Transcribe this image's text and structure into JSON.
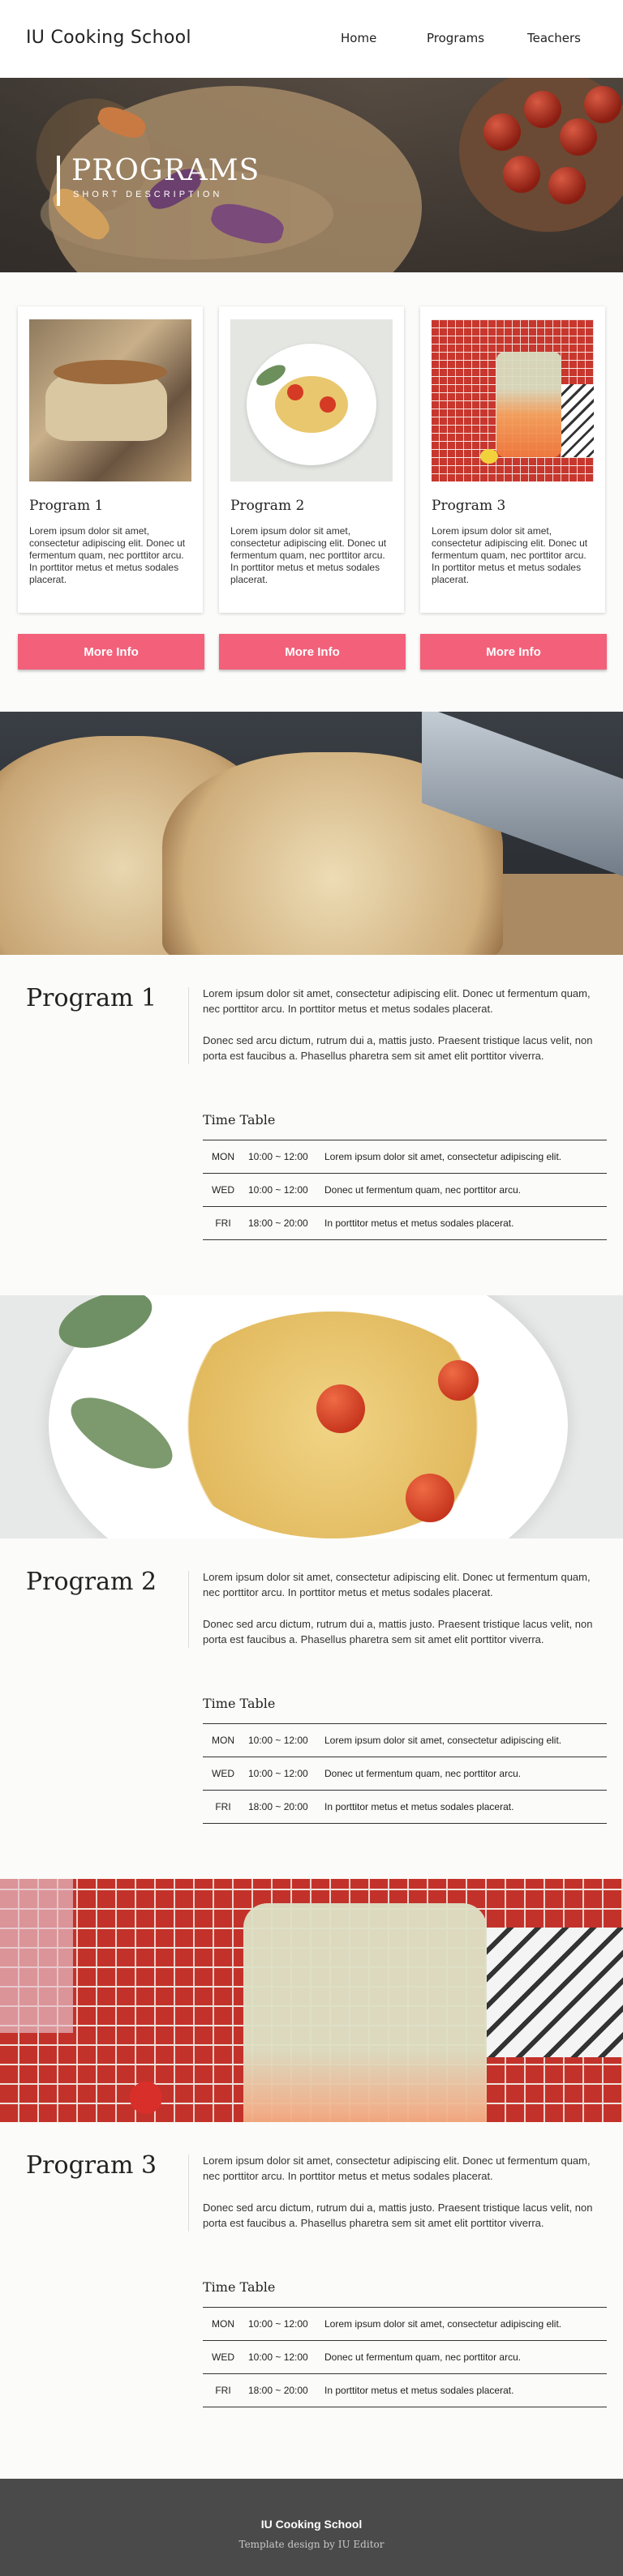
{
  "site": {
    "name": "IU Cooking School"
  },
  "nav": {
    "items": [
      "Home",
      "Programs",
      "Teachers"
    ]
  },
  "hero": {
    "title": "PROGRAMS",
    "subtitle": "SHORT DESCRIPTION"
  },
  "cards": [
    {
      "title": "Program 1",
      "text": "Lorem ipsum dolor sit amet, consectetur adipiscing elit. Donec ut fermentum quam, nec porttitor arcu. In porttitor metus et metus sodales placerat.",
      "button": "More Info"
    },
    {
      "title": "Program 2",
      "text": "Lorem ipsum dolor sit amet, consectetur adipiscing elit. Donec ut fermentum quam, nec porttitor arcu. In porttitor metus et metus sodales placerat.",
      "button": "More Info"
    },
    {
      "title": "Program 3",
      "text": "Lorem ipsum dolor sit amet, consectetur adipiscing elit. Donec ut fermentum quam, nec porttitor arcu. In porttitor metus et metus sodales placerat.",
      "button": "More Info"
    }
  ],
  "programs": [
    {
      "title": "Program 1",
      "para1": "Lorem ipsum dolor sit amet, consectetur adipiscing elit. Donec ut fermentum quam, nec porttitor arcu. In porttitor metus et metus sodales placerat.",
      "para2": "Donec sed arcu dictum, rutrum dui a, mattis justo. Praesent tristique lacus velit, non porta est faucibus a. Phasellus pharetra sem sit amet elit porttitor viverra.",
      "timetable_title": "Time Table",
      "timetable": [
        {
          "day": "MON",
          "time": "10:00 ~ 12:00",
          "desc": "Lorem ipsum dolor sit amet, consectetur adipiscing elit."
        },
        {
          "day": "WED",
          "time": "10:00 ~ 12:00",
          "desc": "Donec ut fermentum quam, nec porttitor arcu."
        },
        {
          "day": "FRI",
          "time": "18:00 ~ 20:00",
          "desc": "In porttitor metus et metus sodales placerat."
        }
      ]
    },
    {
      "title": "Program 2",
      "para1": "Lorem ipsum dolor sit amet, consectetur adipiscing elit. Donec ut fermentum quam, nec porttitor arcu. In porttitor metus et metus sodales placerat.",
      "para2": "Donec sed arcu dictum, rutrum dui a, mattis justo. Praesent tristique lacus velit, non porta est faucibus a. Phasellus pharetra sem sit amet elit porttitor viverra.",
      "timetable_title": "Time Table",
      "timetable": [
        {
          "day": "MON",
          "time": "10:00 ~ 12:00",
          "desc": "Lorem ipsum dolor sit amet, consectetur adipiscing elit."
        },
        {
          "day": "WED",
          "time": "10:00 ~ 12:00",
          "desc": "Donec ut fermentum quam, nec porttitor arcu."
        },
        {
          "day": "FRI",
          "time": "18:00 ~ 20:00",
          "desc": "In porttitor metus et metus sodales placerat."
        }
      ]
    },
    {
      "title": "Program 3",
      "para1": "Lorem ipsum dolor sit amet, consectetur adipiscing elit. Donec ut fermentum quam, nec porttitor arcu. In porttitor metus et metus sodales placerat.",
      "para2": "Donec sed arcu dictum, rutrum dui a, mattis justo. Praesent tristique lacus velit, non porta est faucibus a. Phasellus pharetra sem sit amet elit porttitor viverra.",
      "timetable_title": "Time Table",
      "timetable": [
        {
          "day": "MON",
          "time": "10:00 ~ 12:00",
          "desc": "Lorem ipsum dolor sit amet, consectetur adipiscing elit."
        },
        {
          "day": "WED",
          "time": "10:00 ~ 12:00",
          "desc": "Donec ut fermentum quam, nec porttitor arcu."
        },
        {
          "day": "FRI",
          "time": "18:00 ~ 20:00",
          "desc": "In porttitor metus et metus sodales placerat."
        }
      ]
    }
  ],
  "footer": {
    "name": "IU Cooking School",
    "credit": "Template design by IU Editor"
  },
  "colors": {
    "accent": "#f3607a",
    "footer_bg": "#4a4a4a",
    "header_bg": "#ffffff"
  }
}
